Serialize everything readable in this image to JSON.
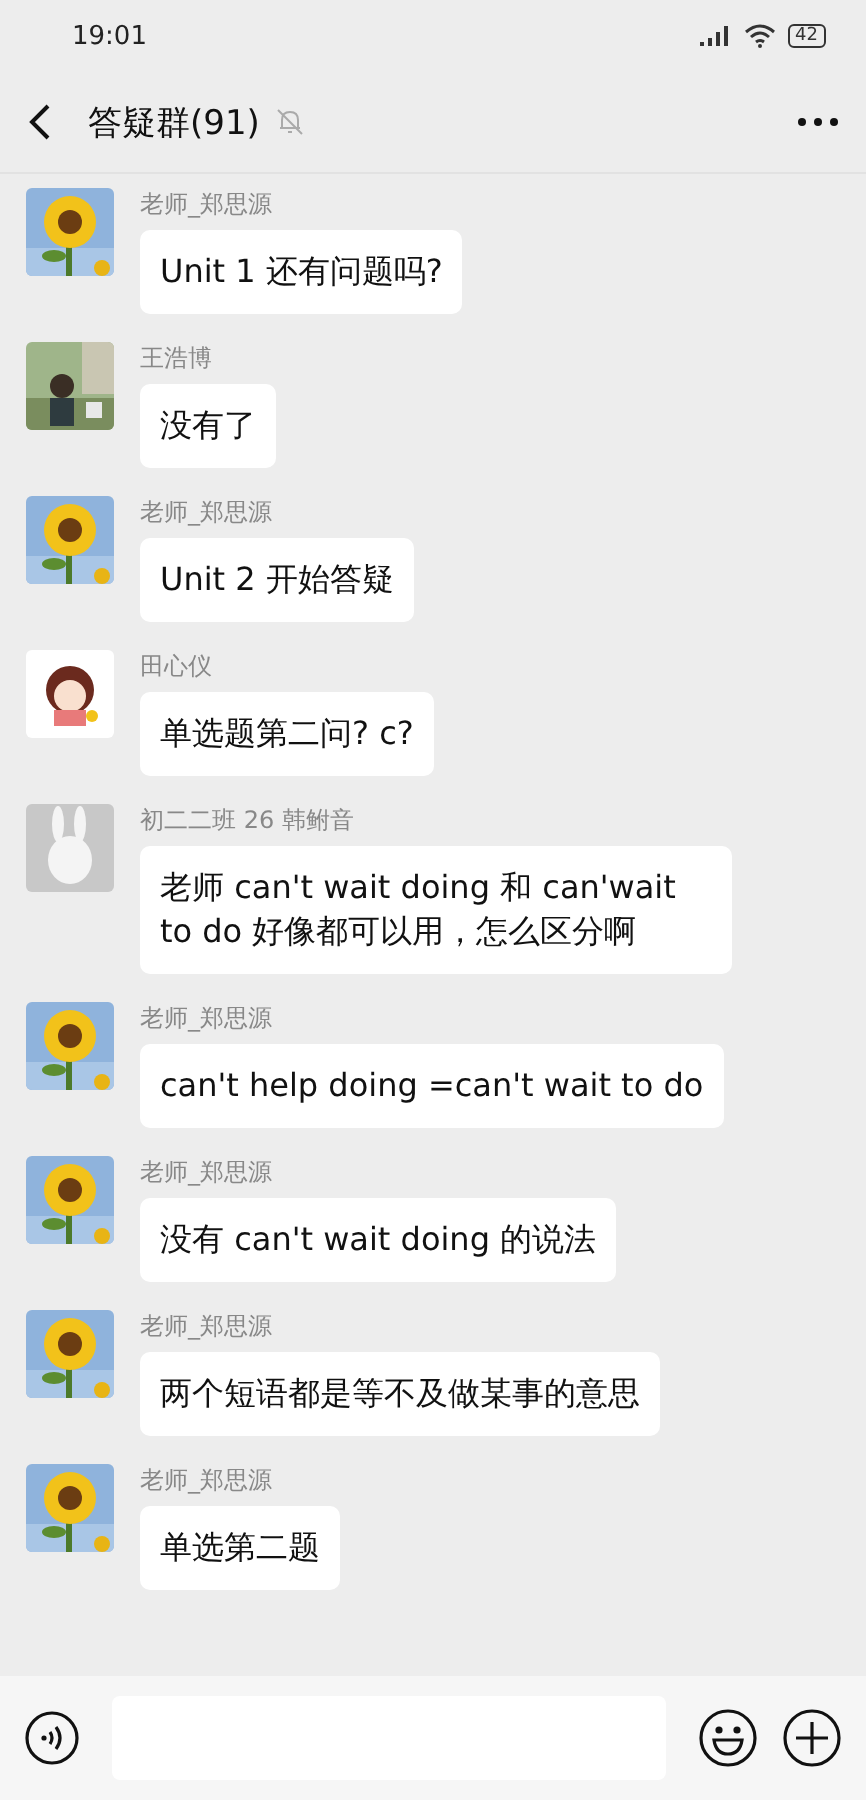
{
  "status_bar": {
    "time": "19:01",
    "battery": "42"
  },
  "header": {
    "title": "答疑群(91)",
    "muted": true
  },
  "messages": [
    {
      "sender": "老师_郑思源",
      "text": "Unit 1 还有问题吗?"
    },
    {
      "sender": "王浩博",
      "text": "没有了"
    },
    {
      "sender": "老师_郑思源",
      "text": "Unit 2 开始答疑"
    },
    {
      "sender": "田心仪",
      "text": "单选题第二问? c?"
    },
    {
      "sender": "初二二班 26 韩鲋音",
      "text": "老师 can't wait doing 和 can'wait to do 好像都可以用，怎么区分啊"
    },
    {
      "sender": "老师_郑思源",
      "text": "can't help doing =can't wait to do"
    },
    {
      "sender": "老师_郑思源",
      "text": "没有 can't wait doing 的说法"
    },
    {
      "sender": "老师_郑思源",
      "text": "两个短语都是等不及做某事的意思"
    },
    {
      "sender": "老师_郑思源",
      "text": "单选第二题"
    }
  ]
}
